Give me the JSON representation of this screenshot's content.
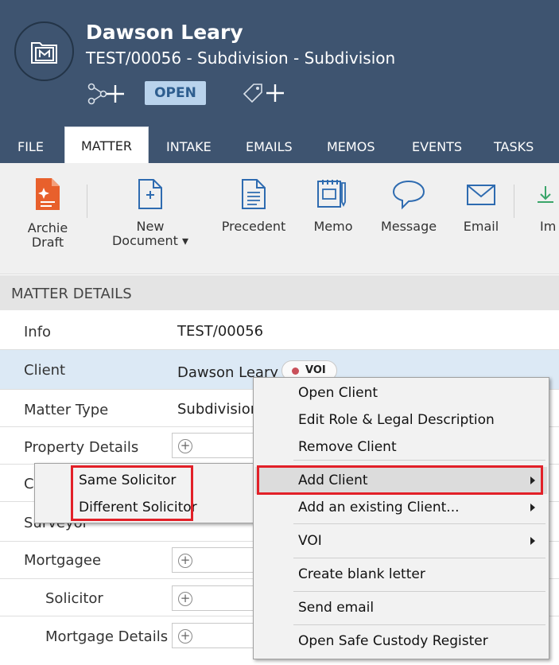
{
  "header": {
    "title": "Dawson Leary",
    "subtitle": "TEST/00056 - Subdivision - Subdivision",
    "status": "OPEN"
  },
  "tabs": [
    "FILE",
    "MATTER",
    "INTAKE",
    "EMAILS",
    "MEMOS",
    "EVENTS",
    "TASKS"
  ],
  "ribbon": {
    "archie_line1": "Archie",
    "archie_line2": "Draft",
    "new_doc_line1": "New",
    "new_doc_line2": "Document ▾",
    "precedent": "Precedent",
    "memo": "Memo",
    "message": "Message",
    "email": "Email",
    "import_partial": "Im"
  },
  "matter_details": {
    "heading": "MATTER DETAILS",
    "info_label": "Info",
    "info_value": "TEST/00056",
    "client_label": "Client",
    "client_value": "Dawson Leary",
    "voi_badge": "VOI",
    "matter_type_label": "Matter Type",
    "matter_type_value": "Subdivision",
    "property_details_label": "Property Details",
    "partial_row_label": "C",
    "surveyor_label": "Surveyor",
    "mortgagee_label": "Mortgagee",
    "solicitor_label": "Solicitor",
    "mortgage_details_label": "Mortgage Details"
  },
  "context_menu": {
    "open_client": "Open Client",
    "edit_role": "Edit Role & Legal Description",
    "remove_client": "Remove Client",
    "add_client": "Add Client",
    "add_existing": "Add an existing Client...",
    "voi": "VOI",
    "create_blank_letter": "Create blank letter",
    "send_email": "Send email",
    "open_safe_custody": "Open Safe Custody Register"
  },
  "submenu": {
    "same_solicitor": "Same Solicitor",
    "different_solicitor": "Different Solicitor"
  },
  "colors": {
    "header_bg": "#3e5470",
    "status_badge_bg": "#b9d3ec",
    "highlight_border": "#e22028",
    "selected_row": "#dce9f5"
  }
}
